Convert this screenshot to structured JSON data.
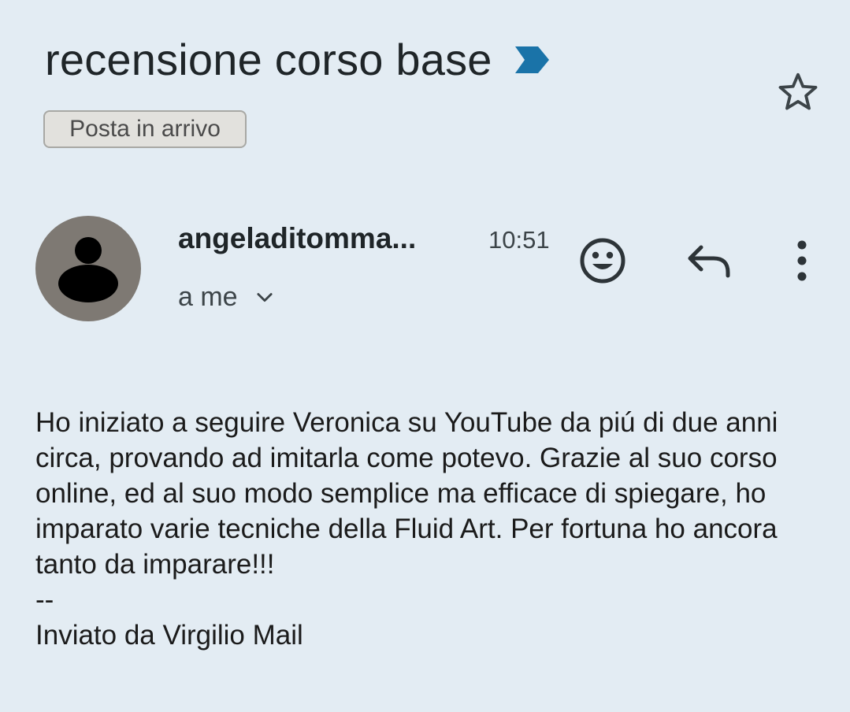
{
  "email": {
    "subject": "recensione corso base",
    "label": "Posta in arrivo",
    "sender": "angeladitomma...",
    "time": "10:51",
    "recipient": "a me",
    "body": "Ho iniziato a seguire Veronica su YouTube da piú di due anni circa, provando ad imitarla come potevo. Grazie al suo corso online, ed al suo modo semplice ma efficace di spiegare, ho imparato varie tecniche della Fluid Art. Per fortuna ho ancora tanto da imparare!!!",
    "signature_separator": "--",
    "signature": "Inviato da Virgilio Mail"
  },
  "icons": {
    "important": "importance-marker-icon",
    "star": "star-outline-icon",
    "avatar": "person-avatar-icon",
    "chevron": "chevron-down-icon",
    "emoji": "add-emoji-reaction-icon",
    "reply": "reply-icon",
    "more": "more-vertical-icon"
  },
  "colors": {
    "background": "#e3ecf3",
    "important_marker": "#1a73a8",
    "avatar_bg": "#7e7973",
    "label_chip_bg": "#e2e1dd"
  }
}
